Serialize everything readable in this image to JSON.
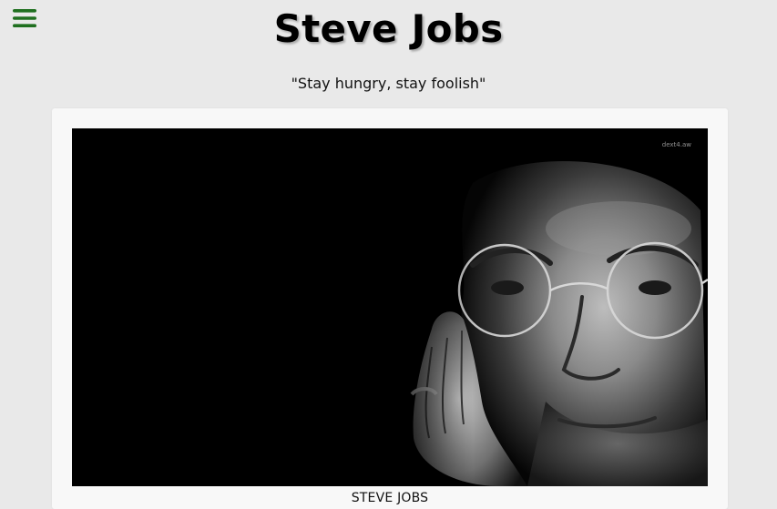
{
  "header": {
    "menu_icon": "hamburger-menu-icon",
    "title": "Steve Jobs",
    "quote": "\"Stay hungry, stay foolish\""
  },
  "card": {
    "image_watermark": "dext4.aw",
    "caption": "STEVE JOBS"
  },
  "colors": {
    "background": "#e9e9e9",
    "card": "#f8f8f8",
    "menu_icon": "#1f6f1f",
    "photo_bg": "#000000"
  }
}
